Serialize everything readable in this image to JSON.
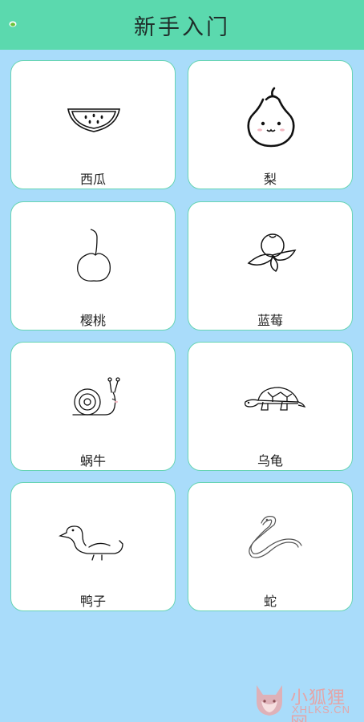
{
  "header": {
    "title": "新手入门"
  },
  "cards": [
    {
      "label": "西瓜",
      "icon": "watermelon-icon"
    },
    {
      "label": "梨",
      "icon": "pear-icon"
    },
    {
      "label": "樱桃",
      "icon": "cherry-icon"
    },
    {
      "label": "蓝莓",
      "icon": "blueberry-icon"
    },
    {
      "label": "蜗牛",
      "icon": "snail-icon"
    },
    {
      "label": "乌龟",
      "icon": "turtle-icon"
    },
    {
      "label": "鸭子",
      "icon": "duck-icon"
    },
    {
      "label": "蛇",
      "icon": "snake-icon"
    }
  ],
  "watermark": {
    "cn": "小狐狸网",
    "en": "XHLKS.CN"
  },
  "colors": {
    "header_bg": "#5bd9ae",
    "page_bg": "#a9dcfa",
    "card_border": "#66d4b3"
  }
}
